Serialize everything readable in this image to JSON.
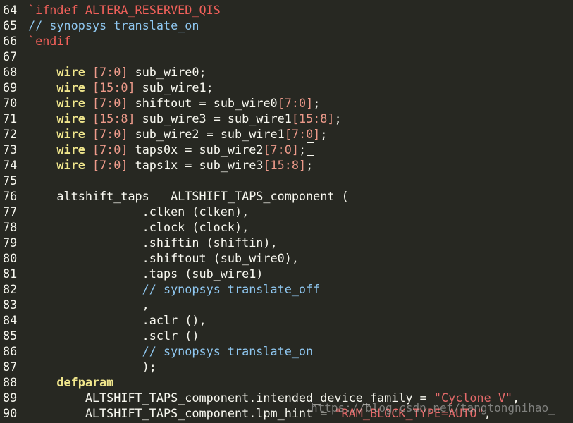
{
  "lines": [
    {
      "n": "64",
      "tokens": [
        [
          "pre",
          "`ifndef ALTERA_RESERVED_QIS"
        ]
      ]
    },
    {
      "n": "65",
      "tokens": [
        [
          "cmt",
          "// synopsys translate_on"
        ]
      ]
    },
    {
      "n": "66",
      "tokens": [
        [
          "pre",
          "`endif"
        ]
      ]
    },
    {
      "n": "67",
      "tokens": []
    },
    {
      "n": "68",
      "tokens": [
        [
          "txt",
          "    "
        ],
        [
          "kw",
          "wire"
        ],
        [
          "txt",
          " "
        ],
        [
          "num",
          "[7:0]"
        ],
        [
          "txt",
          " sub_wire0;"
        ]
      ]
    },
    {
      "n": "69",
      "tokens": [
        [
          "txt",
          "    "
        ],
        [
          "kw",
          "wire"
        ],
        [
          "txt",
          " "
        ],
        [
          "num",
          "[15:0]"
        ],
        [
          "txt",
          " sub_wire1;"
        ]
      ]
    },
    {
      "n": "70",
      "tokens": [
        [
          "txt",
          "    "
        ],
        [
          "kw",
          "wire"
        ],
        [
          "txt",
          " "
        ],
        [
          "num",
          "[7:0]"
        ],
        [
          "txt",
          " shiftout = sub_wire0"
        ],
        [
          "num",
          "[7:0]"
        ],
        [
          "txt",
          ";"
        ]
      ]
    },
    {
      "n": "71",
      "tokens": [
        [
          "txt",
          "    "
        ],
        [
          "kw",
          "wire"
        ],
        [
          "txt",
          " "
        ],
        [
          "num",
          "[15:8]"
        ],
        [
          "txt",
          " sub_wire3 = sub_wire1"
        ],
        [
          "num",
          "[15:8]"
        ],
        [
          "txt",
          ";"
        ]
      ]
    },
    {
      "n": "72",
      "tokens": [
        [
          "txt",
          "    "
        ],
        [
          "kw",
          "wire"
        ],
        [
          "txt",
          " "
        ],
        [
          "num",
          "[7:0]"
        ],
        [
          "txt",
          " sub_wire2 = sub_wire1"
        ],
        [
          "num",
          "[7:0]"
        ],
        [
          "txt",
          ";"
        ]
      ]
    },
    {
      "n": "73",
      "tokens": [
        [
          "txt",
          "    "
        ],
        [
          "kw",
          "wire"
        ],
        [
          "txt",
          " "
        ],
        [
          "num",
          "[7:0]"
        ],
        [
          "txt",
          " taps0x = sub_wire2"
        ],
        [
          "num",
          "[7:0]"
        ],
        [
          "txt",
          ";"
        ],
        [
          "cursor",
          ""
        ]
      ]
    },
    {
      "n": "74",
      "tokens": [
        [
          "txt",
          "    "
        ],
        [
          "kw",
          "wire"
        ],
        [
          "txt",
          " "
        ],
        [
          "num",
          "[7:0]"
        ],
        [
          "txt",
          " taps1x = sub_wire3"
        ],
        [
          "num",
          "[15:8]"
        ],
        [
          "txt",
          ";"
        ]
      ]
    },
    {
      "n": "75",
      "tokens": []
    },
    {
      "n": "76",
      "tokens": [
        [
          "txt",
          "    altshift_taps   ALTSHIFT_TAPS_component ("
        ]
      ]
    },
    {
      "n": "77",
      "tokens": [
        [
          "txt",
          "                .clken (clken),"
        ]
      ]
    },
    {
      "n": "78",
      "tokens": [
        [
          "txt",
          "                .clock (clock),"
        ]
      ]
    },
    {
      "n": "79",
      "tokens": [
        [
          "txt",
          "                .shiftin (shiftin),"
        ]
      ]
    },
    {
      "n": "80",
      "tokens": [
        [
          "txt",
          "                .shiftout (sub_wire0),"
        ]
      ]
    },
    {
      "n": "81",
      "tokens": [
        [
          "txt",
          "                .taps (sub_wire1)"
        ]
      ]
    },
    {
      "n": "82",
      "tokens": [
        [
          "txt",
          "                "
        ],
        [
          "cmt",
          "// synopsys translate_off"
        ]
      ]
    },
    {
      "n": "83",
      "tokens": [
        [
          "txt",
          "                ,"
        ]
      ]
    },
    {
      "n": "84",
      "tokens": [
        [
          "txt",
          "                .aclr (),"
        ]
      ]
    },
    {
      "n": "85",
      "tokens": [
        [
          "txt",
          "                .sclr ()"
        ]
      ]
    },
    {
      "n": "86",
      "tokens": [
        [
          "txt",
          "                "
        ],
        [
          "cmt",
          "// synopsys translate_on"
        ]
      ]
    },
    {
      "n": "87",
      "tokens": [
        [
          "txt",
          "                );"
        ]
      ]
    },
    {
      "n": "88",
      "tokens": [
        [
          "txt",
          "    "
        ],
        [
          "kw",
          "defparam"
        ]
      ]
    },
    {
      "n": "89",
      "tokens": [
        [
          "txt",
          "        ALTSHIFT_TAPS_component.intended_device_family = "
        ],
        [
          "str",
          "\"Cyclone V\""
        ],
        [
          "txt",
          ","
        ]
      ]
    },
    {
      "n": "90",
      "tokens": [
        [
          "txt",
          "        ALTSHIFT_TAPS_component.lpm_hint = "
        ],
        [
          "str",
          "\"RAM_BLOCK_TYPE=AUTO\""
        ],
        [
          "txt",
          ","
        ]
      ]
    }
  ],
  "watermark": "https://blog.csdn.net/tangtongnihao_",
  "colors": {
    "background": "#272822",
    "keyword": "#f0e68c",
    "preprocessor": "#f0605a",
    "number_range": "#ed9a8a",
    "comment": "#8fc7f0",
    "string": "#e46a6a",
    "text": "#f8f8f0"
  }
}
